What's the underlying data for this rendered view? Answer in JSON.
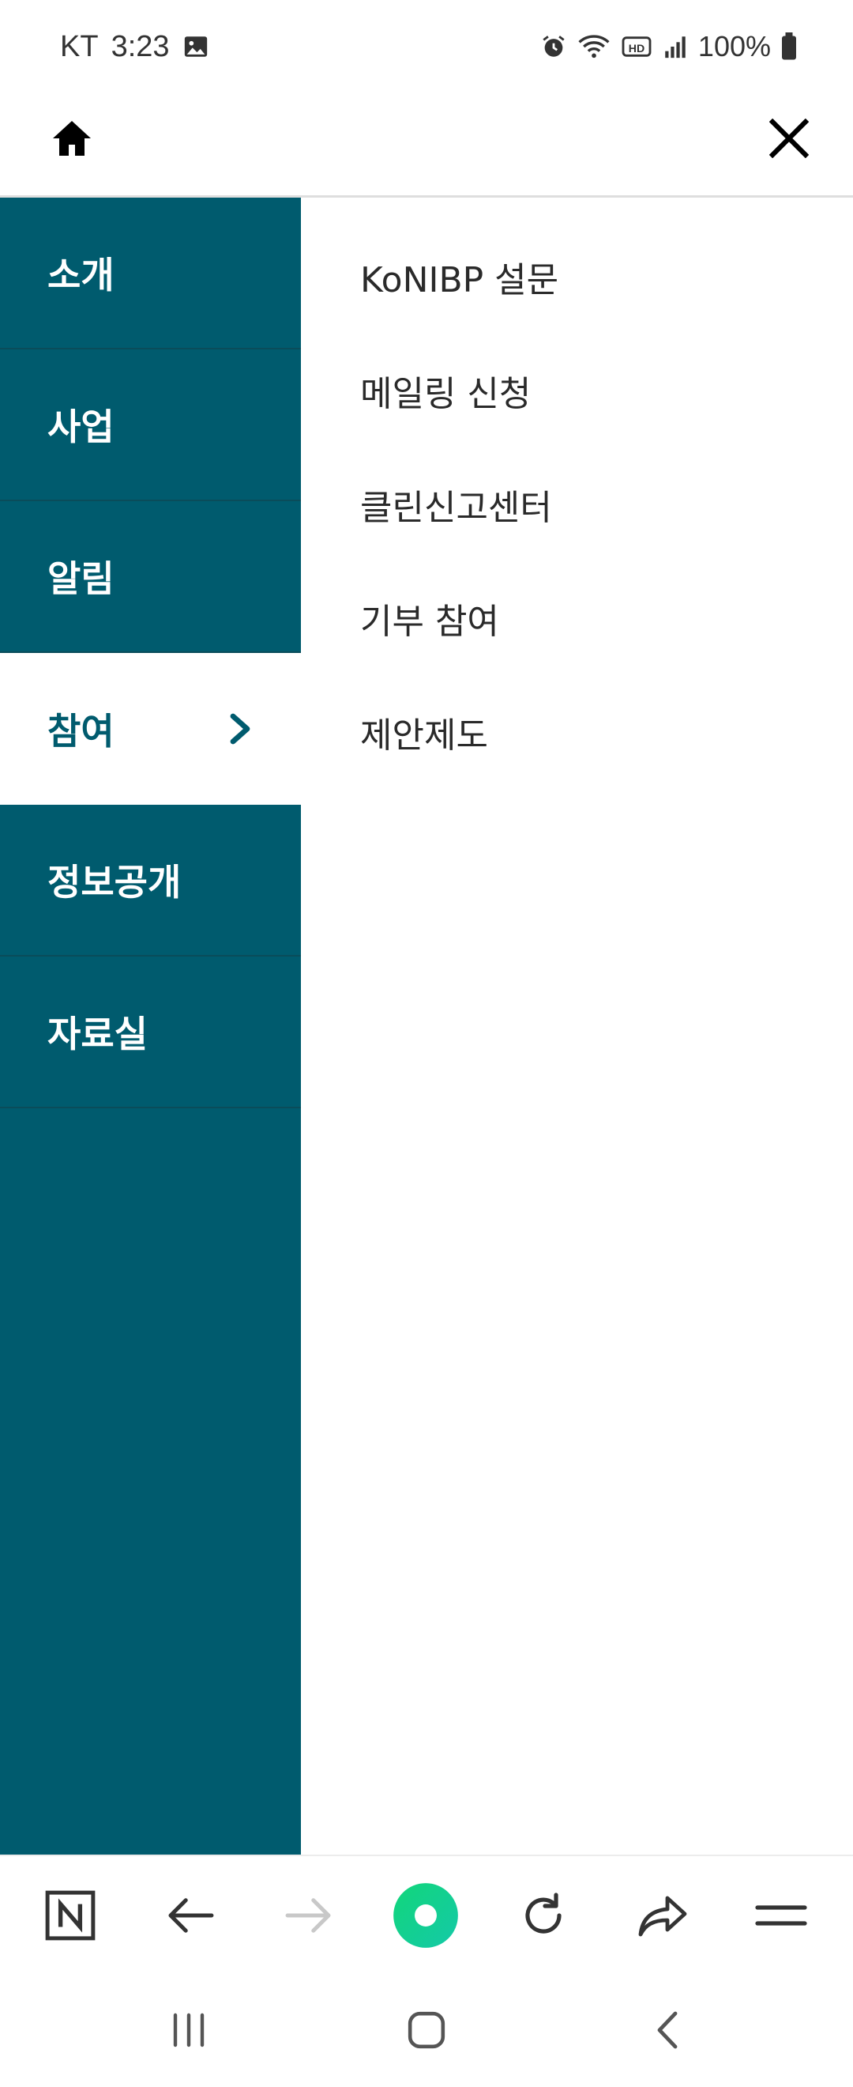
{
  "status_bar": {
    "carrier": "KT",
    "time": "3:23",
    "battery": "100%",
    "icons": [
      "image-icon",
      "alarm-icon",
      "wifi-icon",
      "hd-icon",
      "signal-icon",
      "battery-icon"
    ]
  },
  "header": {
    "home_icon": "home-icon",
    "close_icon": "close-icon"
  },
  "menu": {
    "items": [
      {
        "label": "소개"
      },
      {
        "label": "사업"
      },
      {
        "label": "알림"
      },
      {
        "label": "참여",
        "active": true
      },
      {
        "label": "정보공개"
      },
      {
        "label": "자료실"
      }
    ]
  },
  "submenu": {
    "items": [
      {
        "label": "KoNIBP 설문"
      },
      {
        "label": "메일링 신청"
      },
      {
        "label": "클린신고센터"
      },
      {
        "label": "기부 참여"
      },
      {
        "label": "제안제도"
      }
    ]
  },
  "browser_toolbar": {
    "icons": [
      "naver-n-icon",
      "back-arrow-icon",
      "forward-arrow-icon",
      "green-dot-icon",
      "refresh-icon",
      "share-icon",
      "menu-icon"
    ]
  },
  "system_nav": {
    "icons": [
      "recent-apps-icon",
      "home-square-icon",
      "back-icon"
    ]
  },
  "colors": {
    "menu_bg": "#005b6e",
    "accent_green": "#19d28a"
  }
}
